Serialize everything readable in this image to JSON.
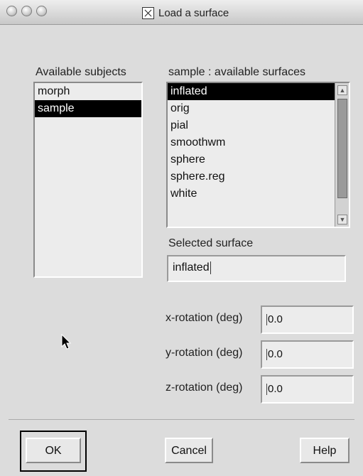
{
  "window": {
    "title": "Load a surface"
  },
  "subjects": {
    "label": "Available subjects",
    "items": [
      "morph",
      "sample"
    ],
    "selected_index": 1
  },
  "surfaces": {
    "label": "sample : available surfaces",
    "items": [
      "inflated",
      "orig",
      "pial",
      "smoothwm",
      "sphere",
      "sphere.reg",
      "white"
    ],
    "selected_index": 0
  },
  "selected_surface": {
    "label": "Selected surface",
    "value": "inflated"
  },
  "rotations": {
    "x_label": "x-rotation (deg)",
    "x_value": "0.0",
    "y_label": "y-rotation (deg)",
    "y_value": "0.0",
    "z_label": "z-rotation (deg)",
    "z_value": "0.0"
  },
  "buttons": {
    "ok": "OK",
    "cancel": "Cancel",
    "help": "Help"
  }
}
